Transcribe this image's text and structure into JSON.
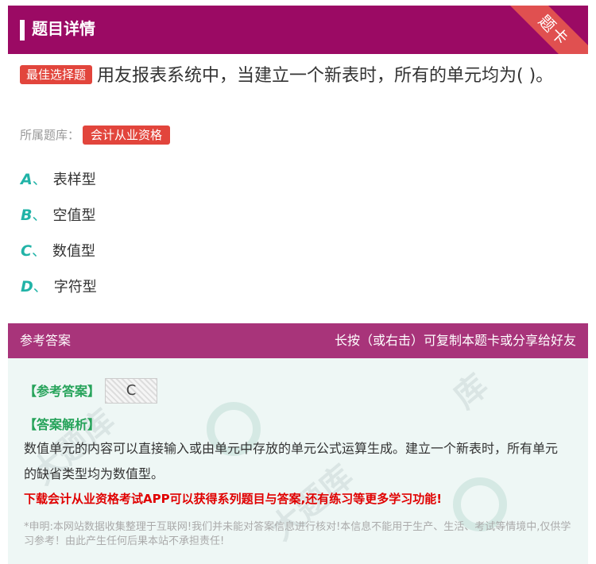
{
  "header": {
    "title": "题目详情",
    "ribbon": "题卡"
  },
  "question": {
    "tag": "最佳选择题",
    "text": "用友报表系统中，当建立一个新表时，所有的单元均为(   )。"
  },
  "bank": {
    "label": "所属题库：",
    "name": "会计从业资格"
  },
  "options": [
    {
      "letter": "A",
      "sep": "、",
      "text": "表样型"
    },
    {
      "letter": "B",
      "sep": "、",
      "text": "空值型"
    },
    {
      "letter": "C",
      "sep": "、",
      "text": "数值型"
    },
    {
      "letter": "D",
      "sep": "、",
      "text": "字符型"
    }
  ],
  "answer_bar": {
    "left": "参考答案",
    "right": "长按（或右击）可复制本题卡或分享给好友"
  },
  "answer": {
    "ref_label": "【参考答案】",
    "ref_value": "C",
    "analysis_label": "【答案解析】",
    "analysis_text": "数值单元的内容可以直接输入或由单元中存放的单元公式运算生成。建立一个新表时，所有单元的缺省类型均为数值型。",
    "promo": "下载会计从业资格考试APP可以获得系列题目与答案,还有练习等更多学习功能!",
    "disclaimer": "*申明:本网站数据收集整理于互联网!我们并未能对答案信息进行核对!本信息不能用于生产、生活、考试等情境中,仅供学习参考！由此产生任何后果本站不承担责任!"
  },
  "colors": {
    "header": "#9b0a64",
    "tag": "#e2453c",
    "option_letter": "#21b3a7",
    "answer_bar": "#a8347a",
    "promo": "#e00000"
  }
}
